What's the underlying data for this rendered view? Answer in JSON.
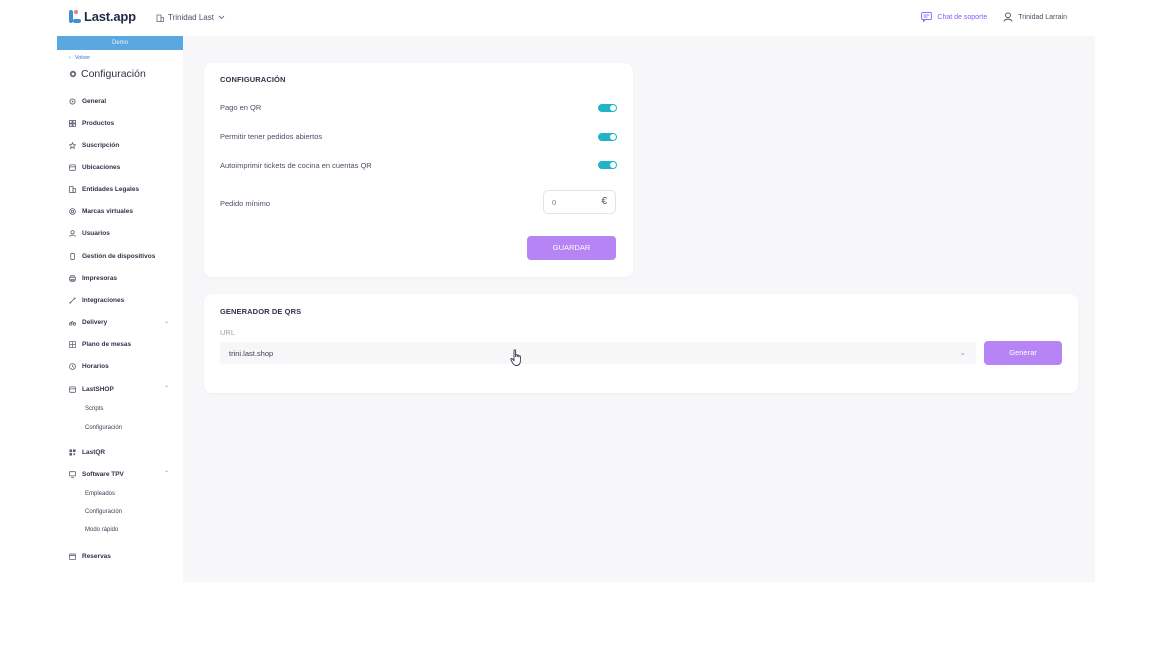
{
  "topbar": {
    "logo_text": "Last.app",
    "org_name": "Trinidad Last",
    "support_label": "Chat de soporte",
    "user_name": "Trinidad Larrain"
  },
  "sidebar": {
    "demo_label": "Demo",
    "back_label": "Volver",
    "title": "Configuración",
    "items": [
      {
        "label": "General",
        "icon": "gear-icon"
      },
      {
        "label": "Productos",
        "icon": "grid-icon"
      },
      {
        "label": "Suscripción",
        "icon": "star-icon"
      },
      {
        "label": "Ubicaciones",
        "icon": "store-icon"
      },
      {
        "label": "Entidades Legales",
        "icon": "building-icon"
      },
      {
        "label": "Marcas virtuales",
        "icon": "brand-icon"
      },
      {
        "label": "Usuarios",
        "icon": "user-icon"
      },
      {
        "label": "Gestión de dispositivos",
        "icon": "device-icon"
      },
      {
        "label": "Impresoras",
        "icon": "printer-icon"
      },
      {
        "label": "Integraciones",
        "icon": "plug-icon"
      },
      {
        "label": "Delivery",
        "icon": "bike-icon"
      },
      {
        "label": "Plano de mesas",
        "icon": "table-icon"
      },
      {
        "label": "Horarios",
        "icon": "clock-icon"
      },
      {
        "label": "LastSHOP",
        "icon": "shop-icon"
      },
      {
        "label": "LastQR",
        "icon": "qr-icon"
      },
      {
        "label": "Software TPV",
        "icon": "monitor-icon"
      },
      {
        "label": "Reservas",
        "icon": "calendar-icon"
      }
    ],
    "lastshop_sub": [
      "Scripts",
      "Configuración"
    ],
    "tpv_sub": [
      "Empleados",
      "Configuración",
      "Modo rápido"
    ]
  },
  "config_card": {
    "title": "CONFIGURACIÓN",
    "toggles": [
      {
        "label": "Pago en QR",
        "on": true
      },
      {
        "label": "Permitir tener pedidos abiertos",
        "on": true
      },
      {
        "label": "Autoimprimir tickets de cocina en cuentas QR",
        "on": true
      }
    ],
    "min_order_label": "Pedido mínimo",
    "min_order_value": "0",
    "currency_symbol": "€",
    "save_label": "GUARDAR"
  },
  "qr_card": {
    "title": "GENERADOR DE QRS",
    "url_label": "URL",
    "url_value": "trini.last.shop",
    "generate_label": "Generar"
  },
  "colors": {
    "accent": "#b684f5",
    "toggle_on": "#1fb5c7",
    "demo_bar": "#5ba7e0",
    "support": "#8b5cf6"
  }
}
